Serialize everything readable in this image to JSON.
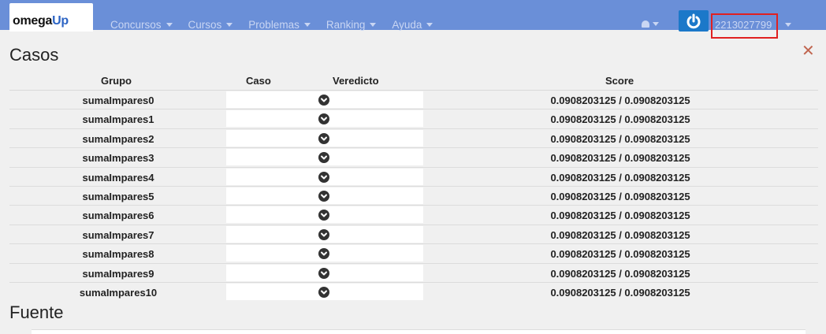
{
  "navbar": {
    "logo_prefix": "omega",
    "logo_suffix": "Up",
    "menu": [
      {
        "label": "Concursos"
      },
      {
        "label": "Cursos"
      },
      {
        "label": "Problemas"
      },
      {
        "label": "Ranking"
      },
      {
        "label": "Ayuda"
      }
    ],
    "username": "2213027799",
    "highlight_color": "#e02020",
    "bar_color": "#6a8fd8"
  },
  "cases": {
    "title": "Casos",
    "close_icon": "close-x-icon",
    "headers": {
      "group": "Grupo",
      "case": "Caso",
      "verdict": "Veredicto",
      "score": "Score"
    },
    "rows": [
      {
        "group": "sumaImpares0",
        "verdict_icon": "check-circle-icon",
        "score": "0.0908203125 / 0.0908203125"
      },
      {
        "group": "sumaImpares1",
        "verdict_icon": "check-circle-icon",
        "score": "0.0908203125 / 0.0908203125"
      },
      {
        "group": "sumaImpares2",
        "verdict_icon": "check-circle-icon",
        "score": "0.0908203125 / 0.0908203125"
      },
      {
        "group": "sumaImpares3",
        "verdict_icon": "check-circle-icon",
        "score": "0.0908203125 / 0.0908203125"
      },
      {
        "group": "sumaImpares4",
        "verdict_icon": "check-circle-icon",
        "score": "0.0908203125 / 0.0908203125"
      },
      {
        "group": "sumaImpares5",
        "verdict_icon": "check-circle-icon",
        "score": "0.0908203125 / 0.0908203125"
      },
      {
        "group": "sumaImpares6",
        "verdict_icon": "check-circle-icon",
        "score": "0.0908203125 / 0.0908203125"
      },
      {
        "group": "sumaImpares7",
        "verdict_icon": "check-circle-icon",
        "score": "0.0908203125 / 0.0908203125"
      },
      {
        "group": "sumaImpares8",
        "verdict_icon": "check-circle-icon",
        "score": "0.0908203125 / 0.0908203125"
      },
      {
        "group": "sumaImpares9",
        "verdict_icon": "check-circle-icon",
        "score": "0.0908203125 / 0.0908203125"
      },
      {
        "group": "sumaImpares10",
        "verdict_icon": "check-circle-icon",
        "score": "0.0908203125 / 0.0908203125"
      }
    ]
  },
  "source": {
    "title": "Fuente"
  }
}
